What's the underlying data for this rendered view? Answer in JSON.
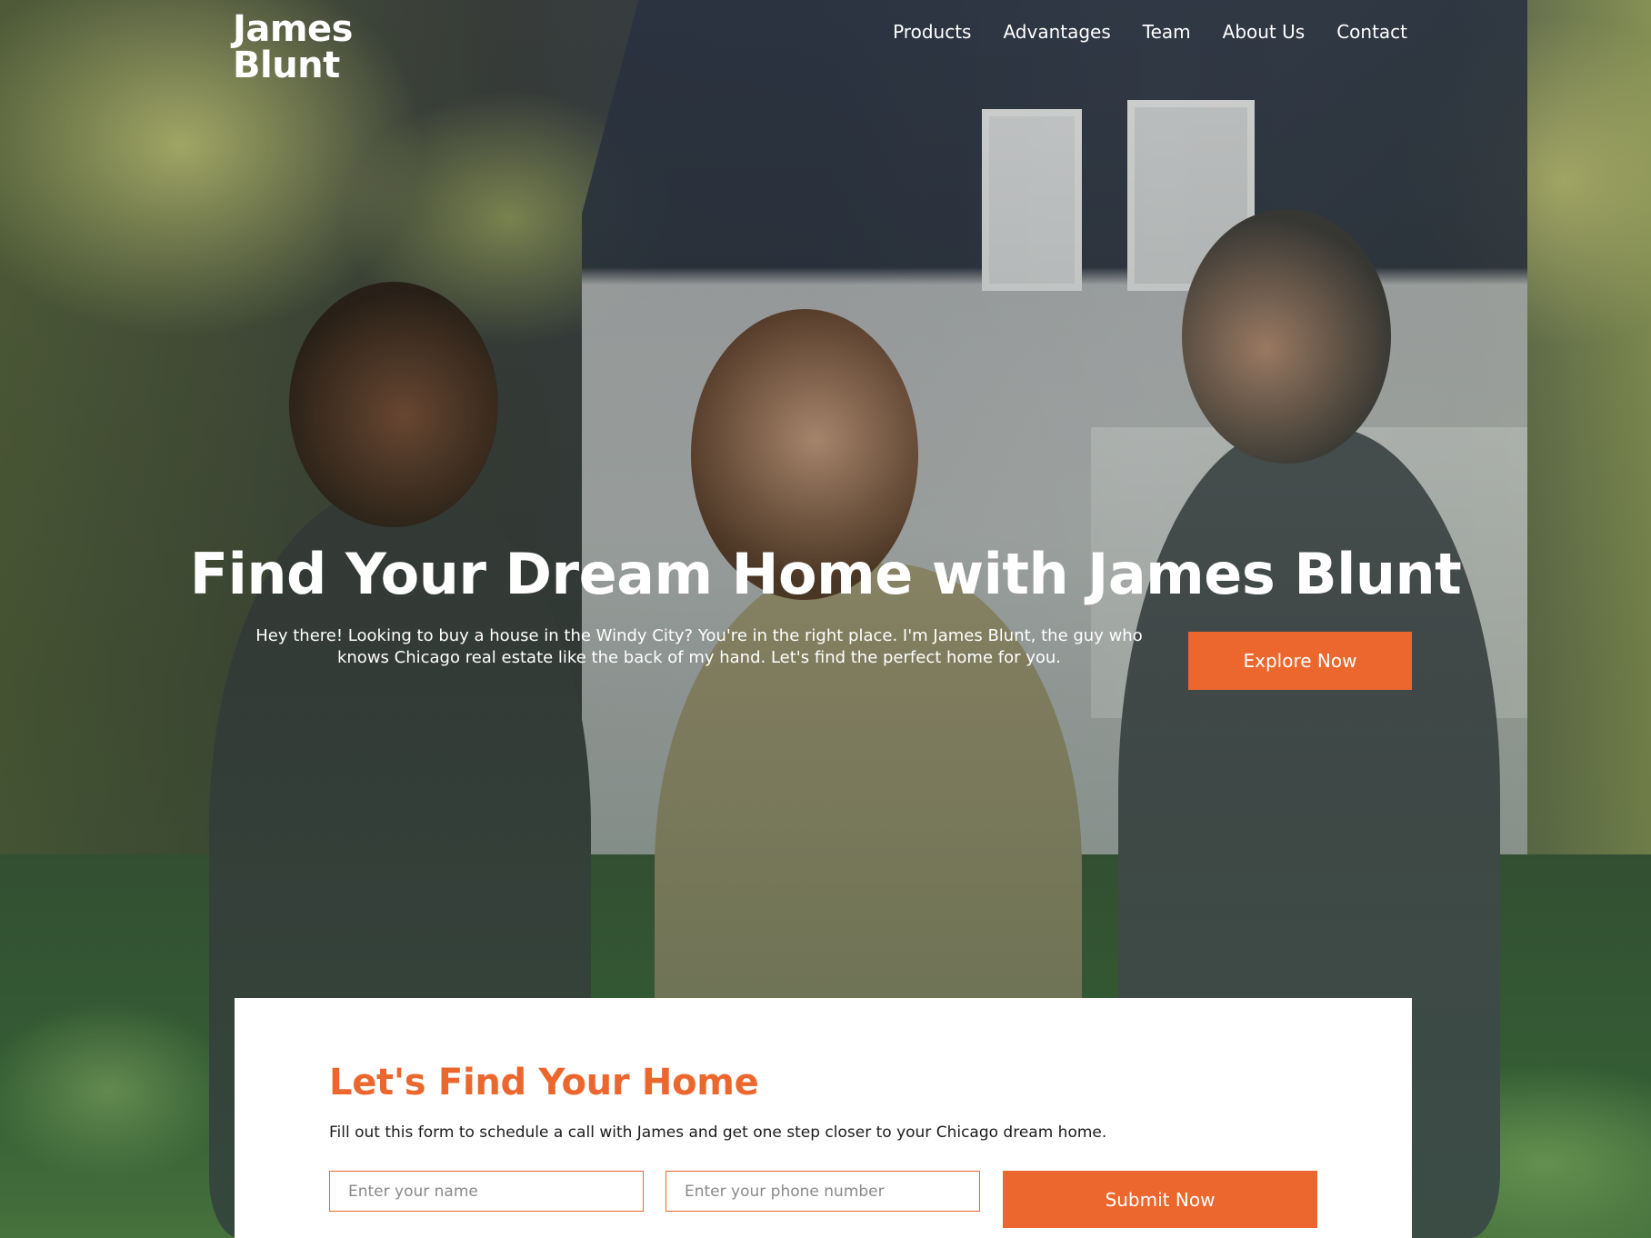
{
  "brand": {
    "logo_line1": "James",
    "logo_line2": "Blunt",
    "accent_color": "#ec672e"
  },
  "nav": {
    "items": [
      {
        "label": "Products"
      },
      {
        "label": "Advantages"
      },
      {
        "label": "Team"
      },
      {
        "label": "About Us"
      },
      {
        "label": "Contact"
      }
    ]
  },
  "hero": {
    "title": "Find Your Dream Home with James Blunt",
    "subtitle": "Hey there! Looking to buy a house in the Windy City? You're in the right place. I'm James Blunt, the guy who knows Chicago real estate like the back of my hand. Let's find the perfect home for you.",
    "cta_label": "Explore Now",
    "background_image": "three-people-smiling-in-front-of-house"
  },
  "form": {
    "title": "Let's Find Your Home",
    "description": "Fill out this form to schedule a call with James and get one step closer to your Chicago dream home.",
    "name_field": {
      "value": "",
      "placeholder": "Enter your name"
    },
    "phone_field": {
      "value": "",
      "placeholder": "Enter your phone number"
    },
    "submit_label": "Submit Now"
  }
}
